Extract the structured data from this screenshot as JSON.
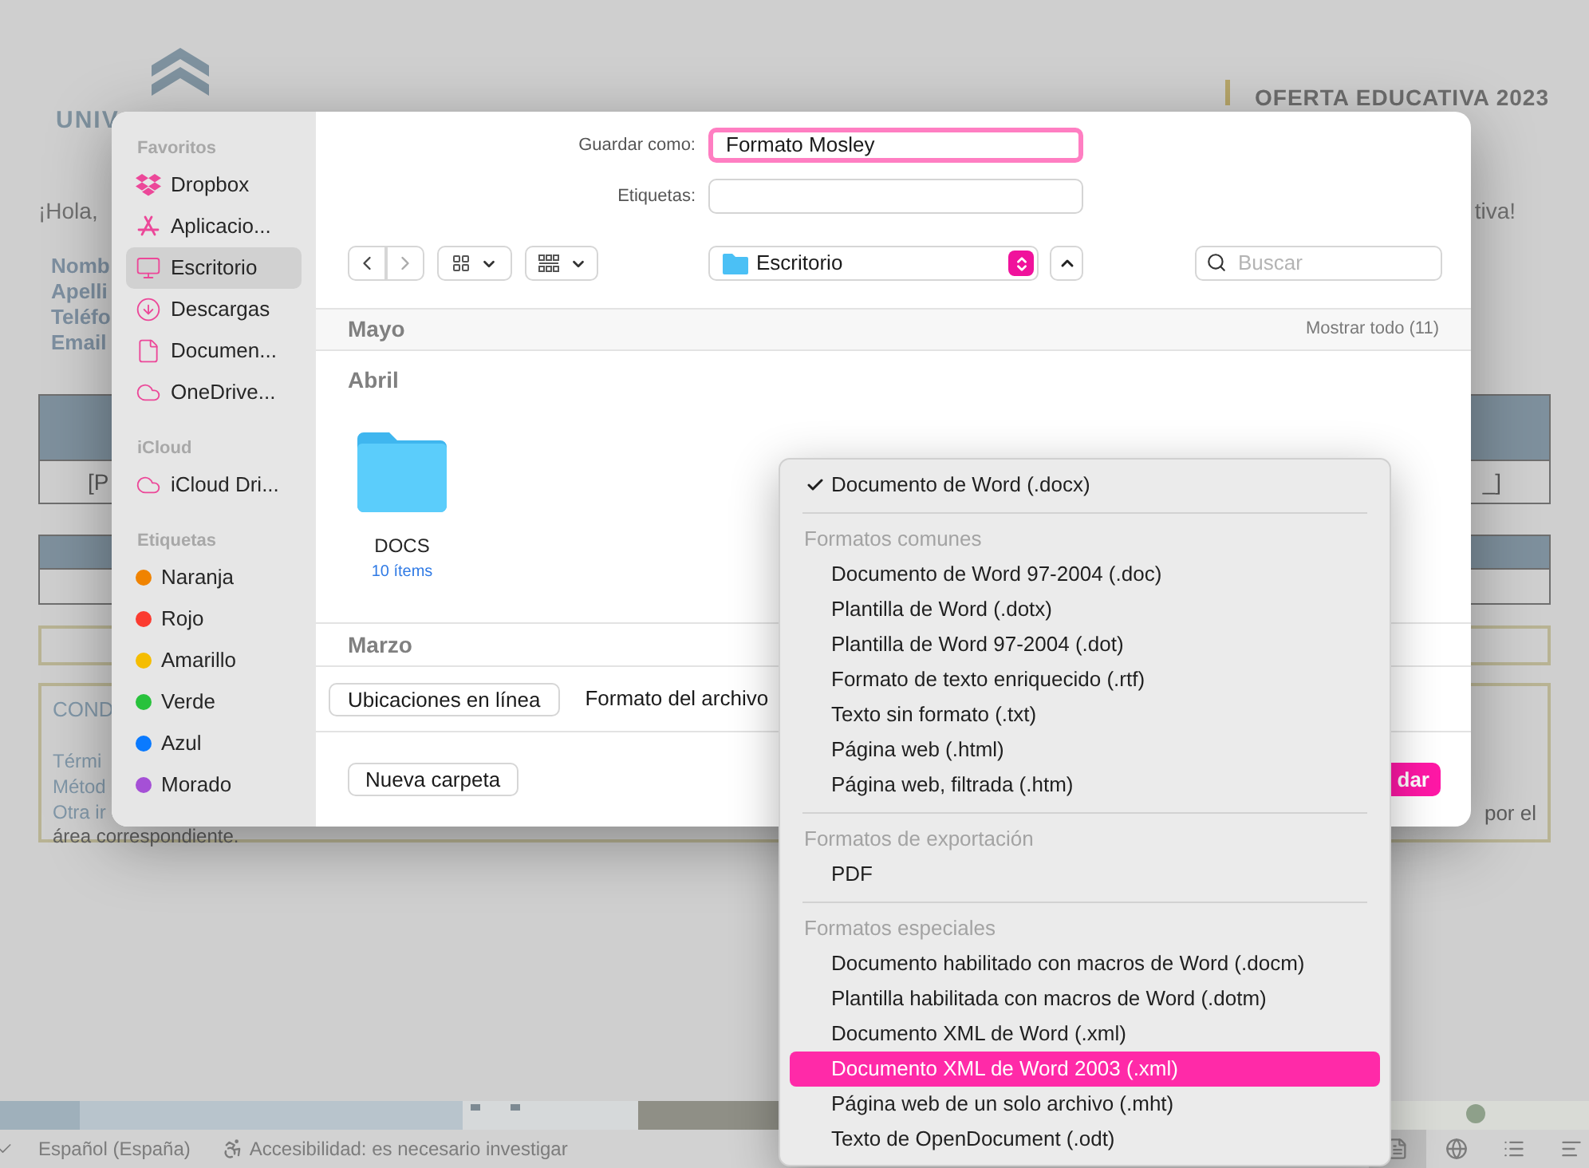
{
  "document": {
    "logo_text": "UNIV",
    "heading": "OFERTA EDUCATIVA 2023",
    "greeting_start": "¡Hola,",
    "greeting_end": "tiva!",
    "field_labels": [
      "Nomb",
      "Apelli",
      "Teléfo",
      "Email"
    ],
    "table_row": {
      "start": "[P",
      "end": "_]"
    },
    "conditions": {
      "title": "COND",
      "lines": [
        "Térmi",
        "Métod",
        "Otra ir"
      ],
      "last_line": "área correspondiente.",
      "line_end": "por el"
    }
  },
  "status_bar": {
    "language": "Español (España)",
    "accessibility": "Accesibilidad: es necesario investigar"
  },
  "save_dialog": {
    "sidebar": [
      {
        "title": "Favoritos",
        "kind": "places",
        "items": [
          {
            "label": "Dropbox",
            "selected": false
          },
          {
            "label": "Aplicacio...",
            "selected": false
          },
          {
            "label": "Escritorio",
            "selected": true
          },
          {
            "label": "Descargas",
            "selected": false
          },
          {
            "label": "Documen...",
            "selected": false
          },
          {
            "label": "OneDrive...",
            "selected": false
          }
        ]
      },
      {
        "title": "iCloud",
        "kind": "cloud",
        "items": [
          {
            "label": "iCloud Dri...",
            "selected": false
          }
        ]
      },
      {
        "title": "Etiquetas",
        "kind": "tags",
        "items": [
          {
            "label": "Naranja",
            "color": "#f08300"
          },
          {
            "label": "Rojo",
            "color": "#fb3b30"
          },
          {
            "label": "Amarillo",
            "color": "#f5bd00"
          },
          {
            "label": "Verde",
            "color": "#28c23c"
          },
          {
            "label": "Azul",
            "color": "#0a7aff"
          },
          {
            "label": "Morado",
            "color": "#a550d6"
          }
        ]
      }
    ],
    "save_as": {
      "label": "Guardar como:",
      "value": "Formato Mosley"
    },
    "tags_field": {
      "label": "Etiquetas:"
    },
    "location": "Escritorio",
    "search": {
      "placeholder": "Buscar"
    },
    "groups": [
      {
        "title": "Mayo",
        "action": "Mostrar todo (11)"
      },
      {
        "title": "Abril",
        "files": [
          {
            "name": "DOCS",
            "detail": "10 ítems"
          }
        ]
      },
      {
        "title": "Marzo"
      }
    ],
    "online_button": "Ubicaciones en línea",
    "format_label": "Formato del archivo",
    "new_folder_button": "Nueva carpeta",
    "save_button": "dar"
  },
  "format_menu": [
    {
      "kind": "option",
      "label": "Documento de Word (.docx)",
      "checked": true,
      "selected": false
    },
    {
      "kind": "separator"
    },
    {
      "kind": "header",
      "label": "Formatos comunes"
    },
    {
      "kind": "option",
      "label": "Documento de Word 97-2004 (.doc)",
      "checked": false,
      "selected": false
    },
    {
      "kind": "option",
      "label": "Plantilla de Word (.dotx)",
      "checked": false,
      "selected": false
    },
    {
      "kind": "option",
      "label": "Plantilla de Word 97-2004 (.dot)",
      "checked": false,
      "selected": false
    },
    {
      "kind": "option",
      "label": "Formato de texto enriquecido (.rtf)",
      "checked": false,
      "selected": false
    },
    {
      "kind": "option",
      "label": "Texto sin formato (.txt)",
      "checked": false,
      "selected": false
    },
    {
      "kind": "option",
      "label": "Página web (.html)",
      "checked": false,
      "selected": false
    },
    {
      "kind": "option",
      "label": "Página web, filtrada (.htm)",
      "checked": false,
      "selected": false
    },
    {
      "kind": "separator"
    },
    {
      "kind": "header",
      "label": "Formatos de exportación"
    },
    {
      "kind": "option",
      "label": "PDF",
      "checked": false,
      "selected": false
    },
    {
      "kind": "separator"
    },
    {
      "kind": "header",
      "label": "Formatos especiales"
    },
    {
      "kind": "option",
      "label": "Documento habilitado con macros de Word (.docm)",
      "checked": false,
      "selected": false
    },
    {
      "kind": "option",
      "label": "Plantilla habilitada con macros de Word (.dotm)",
      "checked": false,
      "selected": false
    },
    {
      "kind": "option",
      "label": "Documento XML de Word (.xml)",
      "checked": false,
      "selected": false
    },
    {
      "kind": "option",
      "label": "Documento XML de Word 2003 (.xml)",
      "checked": false,
      "selected": true
    },
    {
      "kind": "option",
      "label": "Página web de un solo archivo (.mht)",
      "checked": false,
      "selected": false
    },
    {
      "kind": "option",
      "label": "Texto de OpenDocument (.odt)",
      "checked": false,
      "selected": false
    }
  ]
}
